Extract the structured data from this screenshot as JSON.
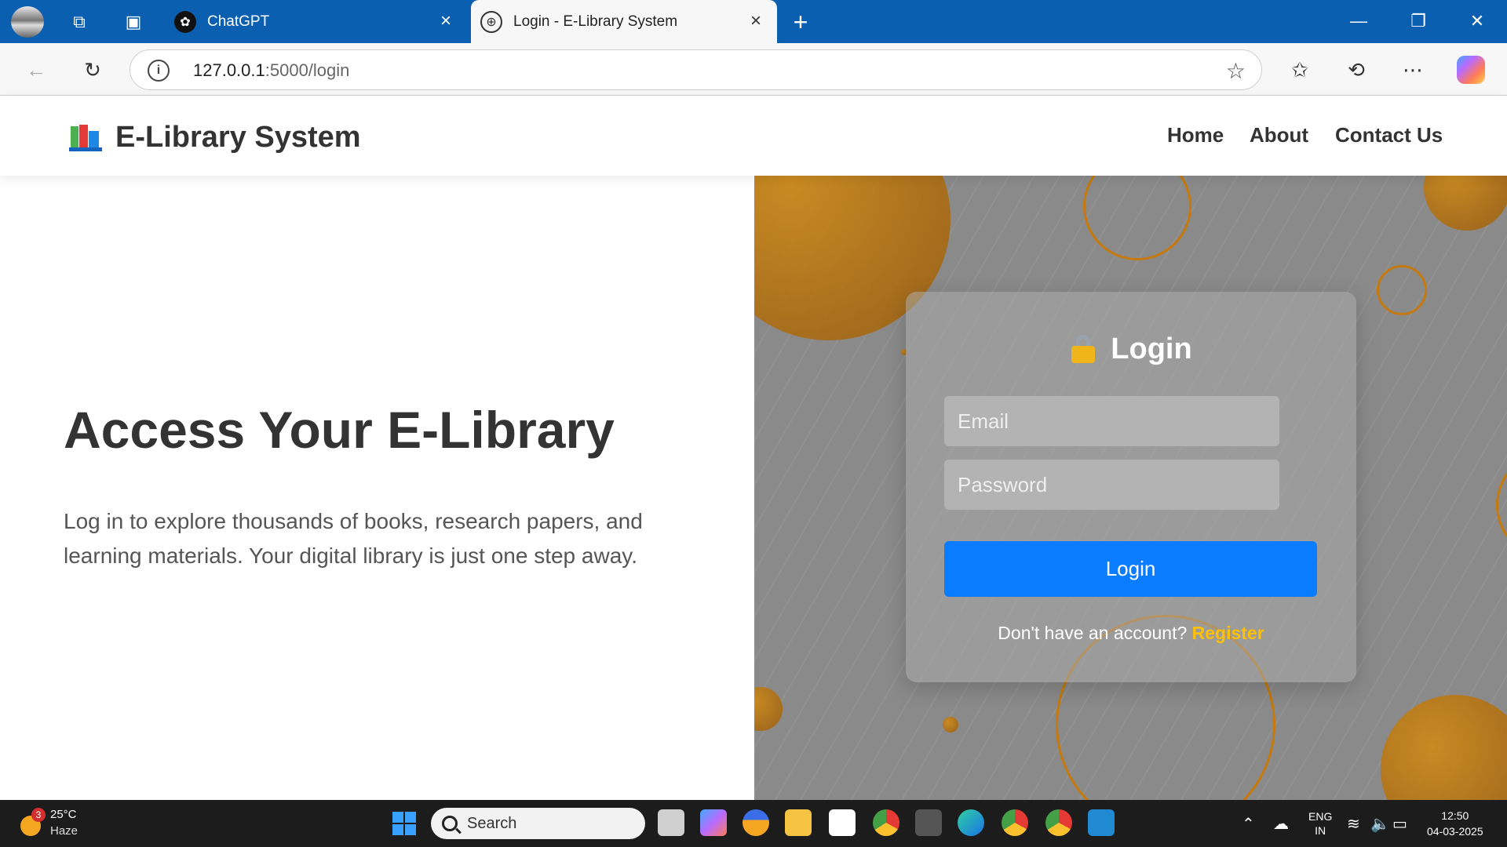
{
  "browser": {
    "tabs": [
      {
        "label": "ChatGPT",
        "favicon": "chatgpt-icon",
        "active": false
      },
      {
        "label": "Login - E-Library System",
        "favicon": "globe-icon",
        "active": true
      }
    ],
    "url_host": "127.0.0.1",
    "url_path": ":5000/login",
    "icons": [
      "back-icon",
      "refresh-icon",
      "info-icon",
      "star-icon",
      "favorites-icon",
      "history-icon",
      "more-icon",
      "copilot-icon"
    ]
  },
  "site": {
    "brand": "E-Library System",
    "brand_icon": "books-icon",
    "nav": [
      "Home",
      "About",
      "Contact Us"
    ]
  },
  "hero": {
    "title": "Access Your E-Library",
    "text": "Log in to explore thousands of books, research papers, and learning materials. Your digital library is just one step away."
  },
  "login": {
    "title": "Login",
    "title_icon": "lock-icon",
    "email_placeholder": "Email",
    "password_placeholder": "Password",
    "button": "Login",
    "register_prompt": "Don't have an account?",
    "register_link": "Register"
  },
  "colors": {
    "accent": "#0a7cff",
    "register_link": "#ffc107",
    "circle_orange": "#c6790c",
    "panel_gray": "#8a8a8a",
    "titlebar": "#0a5fb0"
  },
  "taskbar": {
    "weather_badge": "3",
    "temperature": "25°C",
    "condition": "Haze",
    "search": "Search",
    "language": "ENG",
    "region": "IN",
    "time": "12:50",
    "date": "04-03-2025"
  }
}
